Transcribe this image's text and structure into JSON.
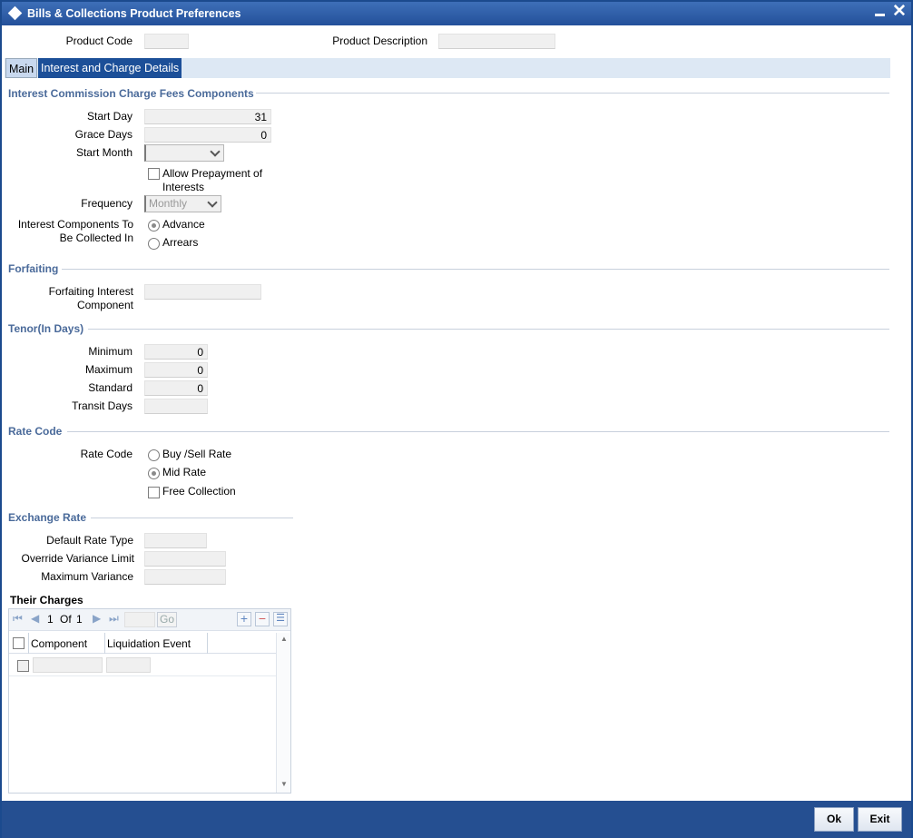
{
  "window": {
    "title": "Bills & Collections Product Preferences"
  },
  "header": {
    "product_code_label": "Product Code",
    "product_code_value": "",
    "product_description_label": "Product Description",
    "product_description_value": ""
  },
  "tabs": [
    {
      "label": "Main"
    },
    {
      "label": "Interest and Charge Details"
    }
  ],
  "interest": {
    "section_title": "Interest Commission Charge Fees Components",
    "start_day_label": "Start Day",
    "start_day_value": "31",
    "grace_days_label": "Grace Days",
    "grace_days_value": "0",
    "start_month_label": "Start Month",
    "start_month_value": "",
    "allow_prepayment_label": "Allow Prepayment of",
    "allow_prepayment_label2": "Interests",
    "frequency_label": "Frequency",
    "frequency_value": "Monthly",
    "components_label1": "Interest Components To",
    "components_label2": "Be Collected In",
    "advance_label": "Advance",
    "arrears_label": "Arrears",
    "selected": "Advance"
  },
  "forfaiting": {
    "section_title": "Forfaiting",
    "component_label1": "Forfaiting Interest",
    "component_label2": "Component",
    "component_value": ""
  },
  "tenor": {
    "section_title": "Tenor(In Days)",
    "minimum_label": "Minimum",
    "minimum_value": "0",
    "maximum_label": "Maximum",
    "maximum_value": "0",
    "standard_label": "Standard",
    "standard_value": "0",
    "transit_label": "Transit Days",
    "transit_value": ""
  },
  "rate_code": {
    "section_title": "Rate Code",
    "label": "Rate Code",
    "buy_sell_label": "Buy /Sell Rate",
    "mid_rate_label": "Mid Rate",
    "selected": "Mid Rate",
    "free_collection_label": "Free Collection"
  },
  "exchange_rate": {
    "section_title": "Exchange Rate",
    "default_rate_type_label": "Default Rate Type",
    "override_variance_label": "Override Variance Limit",
    "maximum_variance_label": "Maximum Variance"
  },
  "their_charges": {
    "title": "Their Charges",
    "page_current": "1",
    "page_of": "Of",
    "page_total": "1",
    "go_label": "Go",
    "columns": [
      "Component",
      "Liquidation Event"
    ]
  },
  "footer": {
    "ok_label": "Ok",
    "exit_label": "Exit"
  },
  "colors": {
    "title_bar": "#2b5aa3",
    "active_tab": "#1c4f98",
    "section_text": "#4a6a9a",
    "footer": "#254f91"
  }
}
